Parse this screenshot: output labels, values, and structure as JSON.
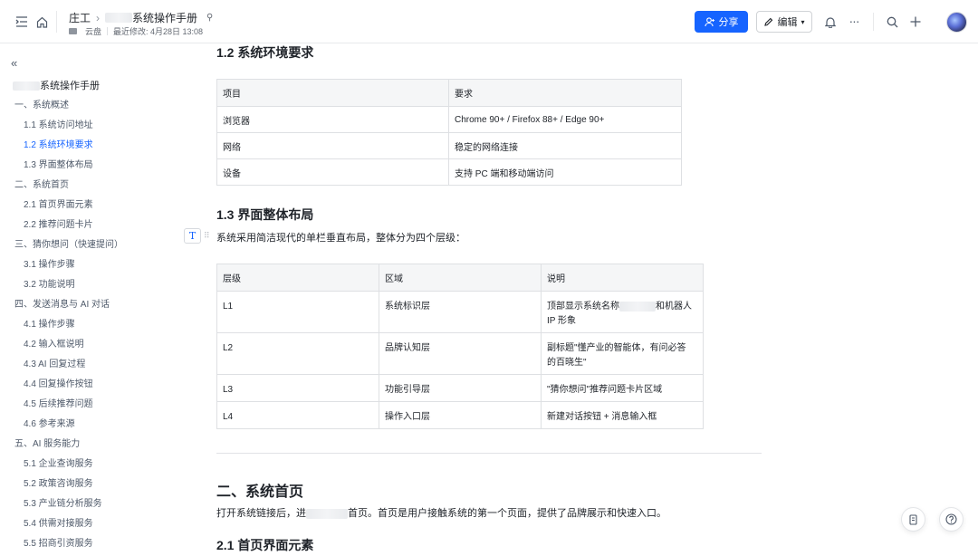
{
  "header": {
    "breadcrumb_root": "庄工",
    "doc_title": "系统操作手册",
    "location": "云盘",
    "last_modified": "最近修改: 4月28日 13:08",
    "share_label": "分享",
    "edit_label": "编辑",
    "accent_color": "#1664ff"
  },
  "sidebar": {
    "title": "系统操作手册",
    "items": [
      {
        "label": "一、系统概述",
        "level": 1
      },
      {
        "label": "1.1 系统访问地址",
        "level": 2
      },
      {
        "label": "1.2 系统环境要求",
        "level": 2,
        "active": true
      },
      {
        "label": "1.3 界面整体布局",
        "level": 2
      },
      {
        "label": "二、系统首页",
        "level": 1
      },
      {
        "label": "2.1 首页界面元素",
        "level": 2
      },
      {
        "label": "2.2 推荐问题卡片",
        "level": 2
      },
      {
        "label": "三、猜你想问（快速提问）",
        "level": 1
      },
      {
        "label": "3.1 操作步骤",
        "level": 2
      },
      {
        "label": "3.2 功能说明",
        "level": 2
      },
      {
        "label": "四、发送消息与 AI 对话",
        "level": 1
      },
      {
        "label": "4.1 操作步骤",
        "level": 2
      },
      {
        "label": "4.2 输入框说明",
        "level": 2
      },
      {
        "label": "4.3 AI 回复过程",
        "level": 2
      },
      {
        "label": "4.4 回复操作按钮",
        "level": 2
      },
      {
        "label": "4.5 后续推荐问题",
        "level": 2
      },
      {
        "label": "4.6 参考来源",
        "level": 2
      },
      {
        "label": "五、AI 服务能力",
        "level": 1
      },
      {
        "label": "5.1 企业查询服务",
        "level": 2
      },
      {
        "label": "5.2 政策咨询服务",
        "level": 2
      },
      {
        "label": "5.3 产业链分析服务",
        "level": 2
      },
      {
        "label": "5.4 供需对接服务",
        "level": 2
      },
      {
        "label": "5.5 招商引资服务",
        "level": 2
      }
    ]
  },
  "content": {
    "s12_heading": "1.2 系统环境要求",
    "env_table": {
      "headers": [
        "项目",
        "要求"
      ],
      "rows": [
        [
          "浏览器",
          "Chrome 90+ / Firefox 88+ / Edge 90+"
        ],
        [
          "网络",
          "稳定的网络连接"
        ],
        [
          "设备",
          "支持 PC 端和移动端访问"
        ]
      ]
    },
    "s13_heading": "1.3 界面整体布局",
    "s13_text": "系统采用简洁现代的单栏垂直布局，整体分为四个层级：",
    "layout_table": {
      "headers": [
        "层级",
        "区域",
        "说明"
      ],
      "rows": [
        [
          "L1",
          "系统标识层",
          "顶部显示系统名称",
          "和机器人",
          "IP 形象"
        ],
        [
          "L2",
          "品牌认知层",
          "副标题\"懂产业的智能体，有问必答",
          "的百晓生\""
        ],
        [
          "L3",
          "功能引导层",
          "\"猜你想问\"推荐问题卡片区域"
        ],
        [
          "L4",
          "操作入口层",
          "新建对话按钮 + 消息输入框"
        ]
      ]
    },
    "s2_heading": "二、系统首页",
    "s2_text_a": "打开系统链接后，进",
    "s2_text_b": "首页。首页是用户接触系统的第一个页面，提供了品牌展示和快速入口。",
    "s21_heading": "2.1 首页界面元素"
  },
  "icons": {
    "menu": "menu-fold-icon",
    "home": "home-icon",
    "pin": "pin-icon",
    "bell": "bell-icon",
    "more": "more-icon",
    "search": "search-icon",
    "add": "plus-icon"
  }
}
